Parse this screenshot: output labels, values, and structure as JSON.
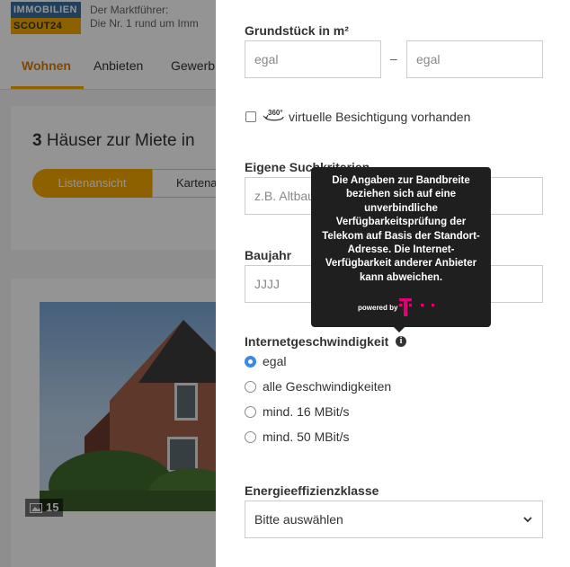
{
  "background": {
    "logo_line1": "IMMOBILIEN",
    "logo_line2": "SCOUT24",
    "tagline_line1": "Der Marktführer:",
    "tagline_line2": "Die Nr. 1 rund um Imm",
    "nav": [
      "Wohnen",
      "Anbieten",
      "Gewerb"
    ],
    "results_count": "3",
    "results_title": "Häuser zur Miete in",
    "view_list": "Listenansicht",
    "view_map": "Kartena",
    "photo_count": "15"
  },
  "filters": {
    "plot_area": {
      "label": "Grundstück in m²",
      "min_placeholder": "egal",
      "separator": "–",
      "max_placeholder": "egal"
    },
    "virtual_tour": {
      "label": "virtuelle Besichtigung vorhanden",
      "checked": false
    },
    "own_criteria": {
      "label": "Eigene Suchkriterien",
      "placeholder": "z.B. Altbau, Ka"
    },
    "year_built": {
      "label": "Baujahr",
      "min_placeholder": "JJJJ"
    },
    "internet_speed": {
      "label": "Internetgeschwindigkeit",
      "options": [
        {
          "label": "egal",
          "selected": true
        },
        {
          "label": "alle Geschwindigkeiten",
          "selected": false
        },
        {
          "label": "mind. 16 MBit/s",
          "selected": false
        },
        {
          "label": "mind. 50 MBit/s",
          "selected": false
        }
      ]
    },
    "energy_class": {
      "label": "Energieeffizienzklasse",
      "selected": "Bitte auswählen"
    }
  },
  "tooltip": {
    "text": "Die Angaben zur Bandbreite beziehen sich auf eine unverbindliche Verfügbarkeitsprüfung der Telekom auf Basis der Standort-Adresse. Die Internet-Verfügbarkeit anderer Anbieter kann abweichen.",
    "powered_by": "powered by"
  },
  "colors": {
    "accent_orange": "#f3a600",
    "radio_blue": "#3b88e6",
    "telekom_magenta": "#e20074",
    "tooltip_bg": "#1f1f1f"
  },
  "icons": [
    "360-icon",
    "info-icon",
    "chevron-down-icon",
    "image-icon",
    "telekom-logo"
  ]
}
